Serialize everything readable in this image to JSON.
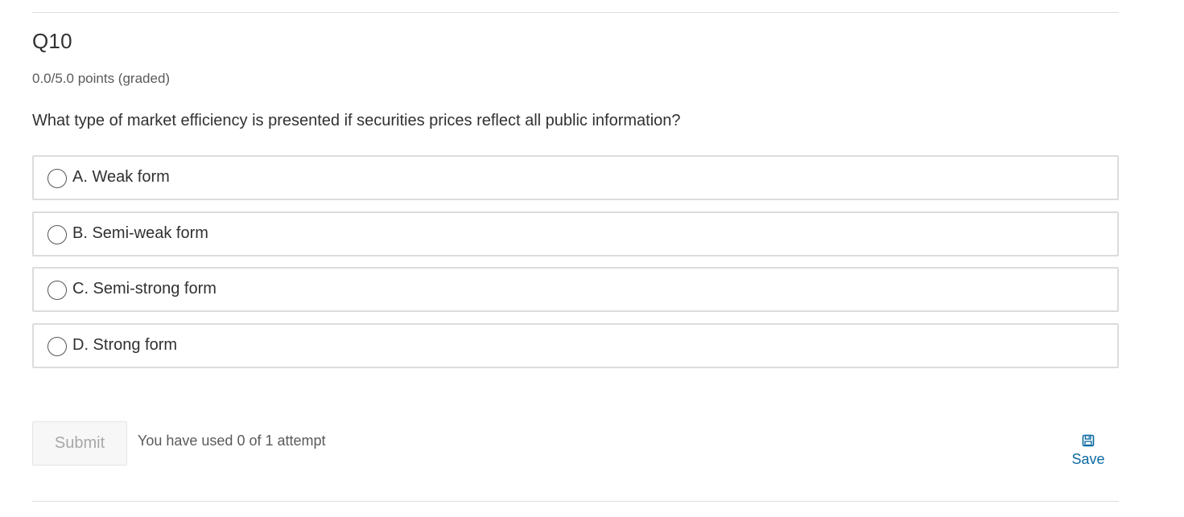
{
  "question": {
    "title": "Q10",
    "points": "0.0/5.0 points (graded)",
    "prompt": "What type of market efficiency is presented if securities prices reflect all public information?"
  },
  "choices": [
    {
      "label": "A. Weak form",
      "selected": false
    },
    {
      "label": "B. Semi-weak form",
      "selected": false
    },
    {
      "label": "C. Semi-strong form",
      "selected": false
    },
    {
      "label": "D. Strong form",
      "selected": false
    }
  ],
  "actions": {
    "submit_label": "Submit",
    "attempts_text": "You have used 0 of 1 attempt",
    "save_label": "Save",
    "save_icon": "floppy-disk-icon"
  },
  "colors": {
    "link": "#0b6aa2",
    "border": "#dcdcdc",
    "text": "#313131",
    "muted_text": "#5a5a5a",
    "disabled_text": "#a7a7a7"
  }
}
